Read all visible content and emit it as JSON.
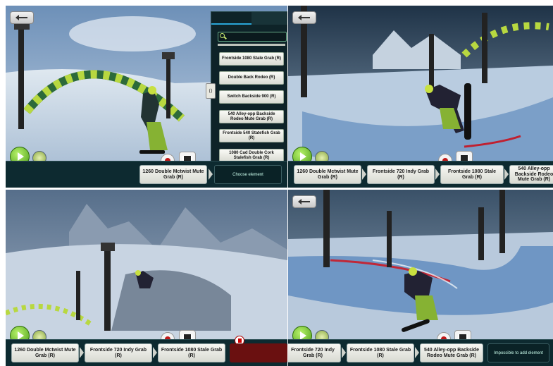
{
  "colors": {
    "timeline_bg": "#0d2a30",
    "accent_green": "#6fc12a",
    "record_red": "#c01818"
  },
  "icons": {
    "back": "back-arrow-icon",
    "play": "play-icon",
    "replay": "replay-icon",
    "record": "record-icon",
    "film": "film-icon",
    "search": "search-icon",
    "delete": "trash-icon",
    "toggle": "left-right-arrows-icon"
  },
  "menu": {
    "tabs": [
      "",
      ""
    ],
    "search_value": "",
    "items": [
      "Frontside 1080 Stale Grab (R)",
      "Double Back Rodeo (R)",
      "Switch Backside 900 (R)",
      "540 Alley-opp Backside Rodeo Mute Grab (R)",
      "Frontside 540 Statefish Grab (R)",
      "1080 Cad Double Cork Stalefish Grab (R)"
    ]
  },
  "panel1": {
    "timeline": [
      "1260 Double Mctwist Mute Grab (R)"
    ],
    "status": "Choose element"
  },
  "panel2": {
    "timeline": [
      "1260 Double Mctwist Mute Grab (R)",
      "Frontside 720 Indy Grab (R)",
      "Frontside 1080 Stale Grab (R)",
      "540 Alley-opp Backside Rodeo Mute Grab (R)"
    ]
  },
  "panel3": {
    "timeline": [
      "1260 Double Mctwist Mute Grab (R)",
      "Frontside 720 Indy Grab (R)",
      "Frontside 1080 Stale Grab (R)"
    ]
  },
  "panel4": {
    "timeline": [
      "Frontside 720 Indy Grab (R)",
      "Frontside 1080 Stale Grab (R)",
      "540 Alley-opp Backside Rodeo Mute Grab (R)"
    ],
    "status": "Impossible to add element"
  }
}
